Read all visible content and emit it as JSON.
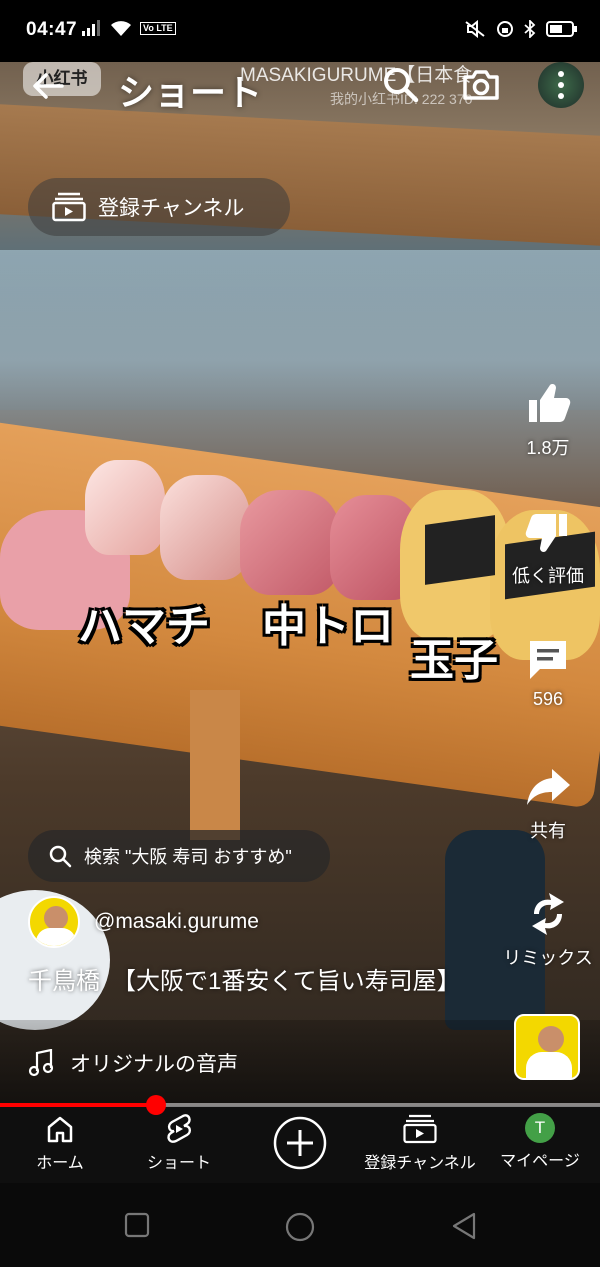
{
  "status_bar": {
    "time": "04:47",
    "volte": "Vo LTE",
    "icons": [
      "signal-icon",
      "wifi-icon",
      "volte-icon",
      "mute-icon",
      "alarm-icon",
      "bluetooth-icon",
      "battery-icon"
    ]
  },
  "video_watermark": {
    "badge": "小红书",
    "channel_text": "MASAKIGURUME【日本食",
    "id_text": "我的小红书ID: 222  370"
  },
  "top_bar": {
    "title": "ショート",
    "icons": [
      "back-arrow-icon",
      "search-icon",
      "camera-icon",
      "more-icon"
    ]
  },
  "subscriptions_chip": {
    "label": "登録チャンネル"
  },
  "video_overlay": {
    "label_1": "ハマチ",
    "label_2": "中トロ",
    "label_3": "玉子"
  },
  "actions": {
    "like_count": "1.8万",
    "dislike_label": "低く評価",
    "comment_count": "596",
    "share_label": "共有",
    "remix_label": "リミックス"
  },
  "search_suggestion": {
    "text": "検索 \"大阪 寿司 おすすめ\""
  },
  "channel": {
    "handle": "@masaki.gurume"
  },
  "video": {
    "title": "千鳥橋　【大阪で1番安くて旨い寿司屋】",
    "audio": "オリジナルの音声",
    "progress": 0.26
  },
  "bottom_nav": {
    "home": "ホーム",
    "shorts": "ショート",
    "subscriptions": "登録チャンネル",
    "me": "マイページ",
    "me_initial": "T"
  },
  "colors": {
    "accent": "#ff0000",
    "avatar_bg": "#f3d800",
    "me_avatar_bg": "#43a047"
  }
}
